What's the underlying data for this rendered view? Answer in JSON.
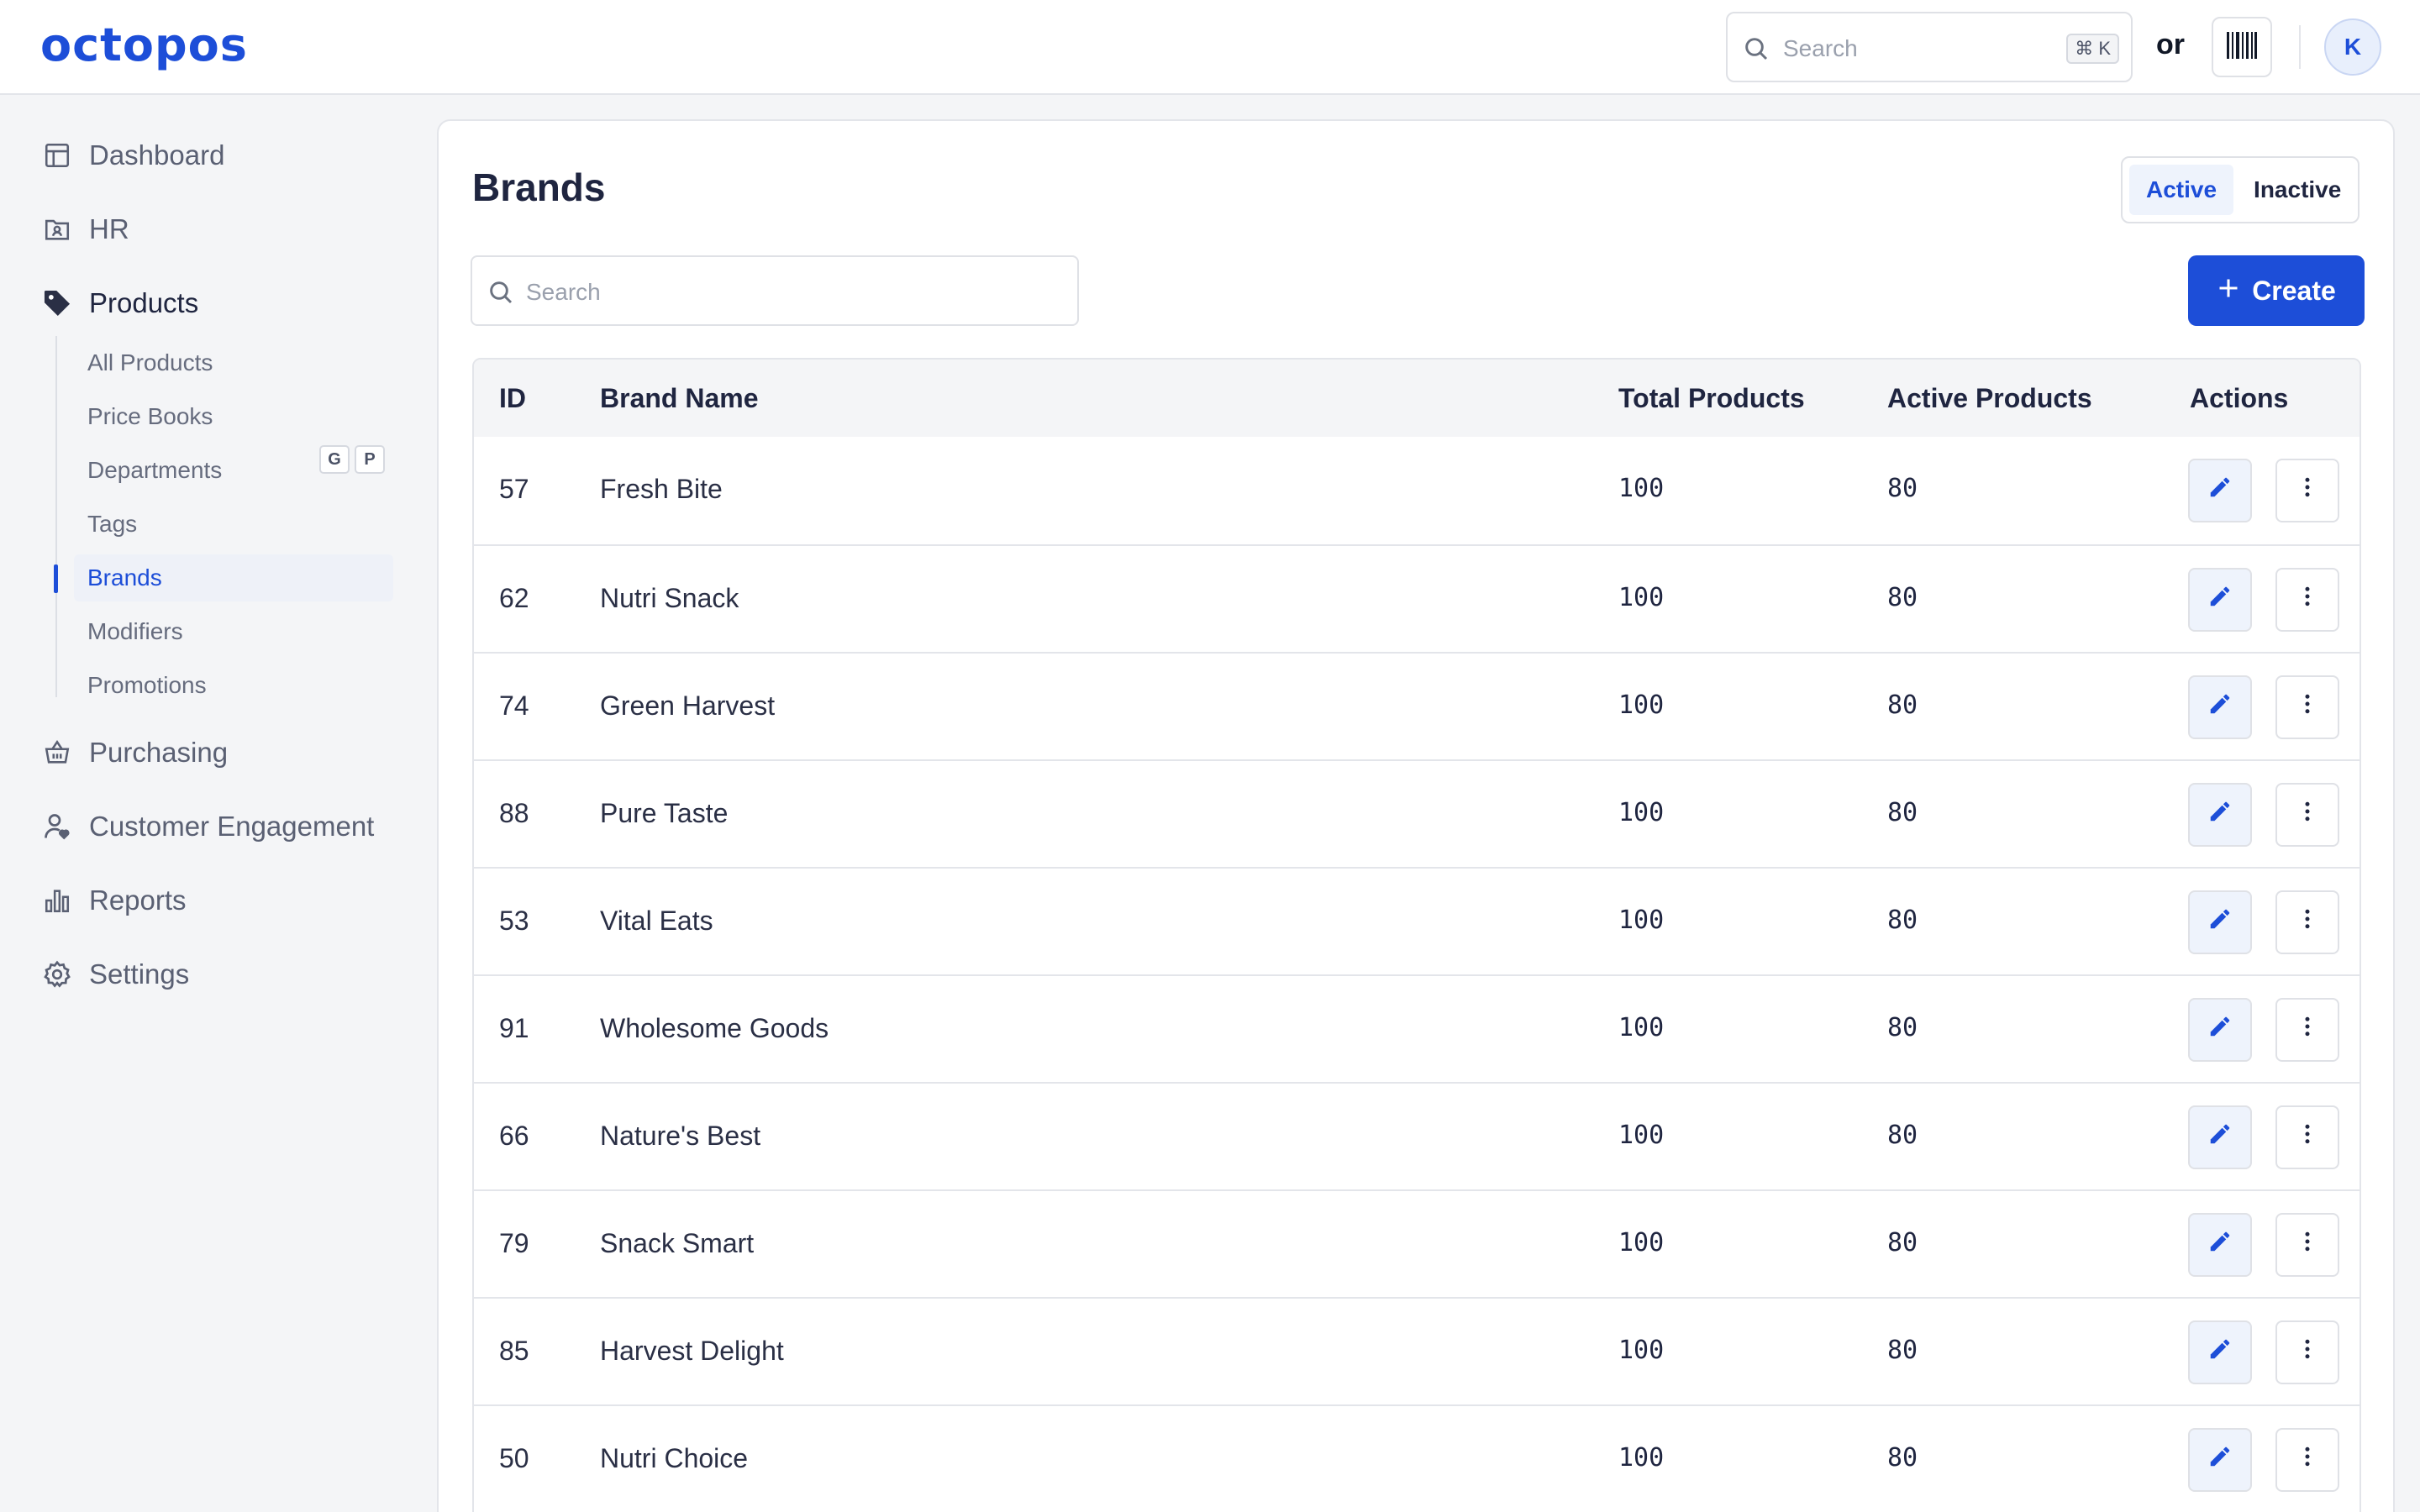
{
  "app": {
    "logo": "octopos"
  },
  "topbar": {
    "search_placeholder": "Search",
    "shortcut": "⌘ K",
    "or_label": "or",
    "barcode_icon": "barcode-icon",
    "avatar_initial": "K"
  },
  "sidebar": {
    "items": [
      {
        "label": "Dashboard",
        "icon": "dashboard-icon"
      },
      {
        "label": "HR",
        "icon": "hr-folder-icon"
      },
      {
        "label": "Products",
        "icon": "tag-icon"
      },
      {
        "label": "Purchasing",
        "icon": "basket-icon"
      },
      {
        "label": "Customer Engagement",
        "icon": "user-heart-icon"
      },
      {
        "label": "Reports",
        "icon": "bar-chart-icon"
      },
      {
        "label": "Settings",
        "icon": "gear-icon"
      }
    ],
    "products_sub": [
      {
        "label": "All Products"
      },
      {
        "label": "Price Books"
      },
      {
        "label": "Departments"
      },
      {
        "label": "Tags"
      },
      {
        "label": "Brands",
        "selected": true
      },
      {
        "label": "Modifiers"
      },
      {
        "label": "Promotions"
      }
    ],
    "all_products_shortcut": [
      "G",
      "P"
    ]
  },
  "page": {
    "title": "Brands",
    "toggle": {
      "active": "Active",
      "inactive": "Inactive",
      "selected": "Active"
    },
    "search_placeholder": "Search",
    "create_label": "Create"
  },
  "table": {
    "columns": [
      "ID",
      "Brand Name",
      "Total Products",
      "Active Products",
      "Actions"
    ],
    "rows": [
      {
        "id": "57",
        "name": "Fresh Bite",
        "total": "100",
        "active": "80"
      },
      {
        "id": "62",
        "name": "Nutri Snack",
        "total": "100",
        "active": "80"
      },
      {
        "id": "74",
        "name": "Green Harvest",
        "total": "100",
        "active": "80"
      },
      {
        "id": "88",
        "name": "Pure Taste",
        "total": "100",
        "active": "80"
      },
      {
        "id": "53",
        "name": "Vital Eats",
        "total": "100",
        "active": "80"
      },
      {
        "id": "91",
        "name": "Wholesome Goods",
        "total": "100",
        "active": "80"
      },
      {
        "id": "66",
        "name": "Nature's Best",
        "total": "100",
        "active": "80"
      },
      {
        "id": "79",
        "name": "Snack Smart",
        "total": "100",
        "active": "80"
      },
      {
        "id": "85",
        "name": "Harvest Delight",
        "total": "100",
        "active": "80"
      },
      {
        "id": "50",
        "name": "Nutri Choice",
        "total": "100",
        "active": "80"
      }
    ]
  },
  "colors": {
    "accent": "#1d4ed8",
    "background": "#f4f5f7",
    "card": "#ffffff",
    "text": "#1f2540"
  }
}
